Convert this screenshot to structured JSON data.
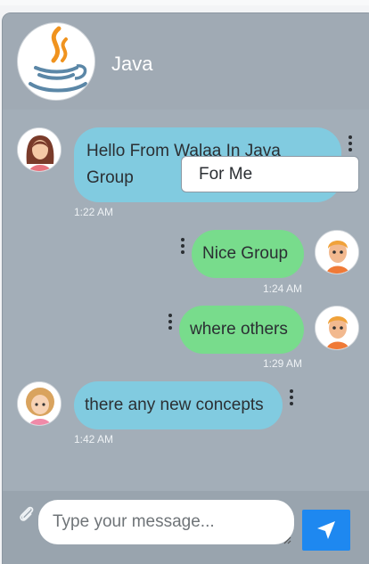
{
  "chat": {
    "title": "Java",
    "icons": {
      "group_avatar": "java-logo-icon",
      "attach": "paperclip-icon",
      "send": "send-arrow-icon",
      "options": "kebab-menu-icon"
    },
    "context_menu": {
      "item": "For Me"
    },
    "messages": [
      {
        "direction": "incoming",
        "avatar": "woman-avatar",
        "text": "Hello From Walaa In Java Group",
        "time": "1:22 AM"
      },
      {
        "direction": "outgoing",
        "avatar": "boy-avatar",
        "text": "Nice Group",
        "time": "1:24 AM"
      },
      {
        "direction": "outgoing",
        "avatar": "boy-avatar",
        "text": "where others",
        "time": "1:29 AM"
      },
      {
        "direction": "incoming",
        "avatar": "girl-avatar",
        "text": "there any new concepts",
        "time": "1:42 AM"
      }
    ],
    "composer": {
      "placeholder": "Type your message..."
    },
    "colors": {
      "incoming_bubble": "#81cbe0",
      "outgoing_bubble": "#78dc8c",
      "send_button": "#1e88f0"
    }
  }
}
